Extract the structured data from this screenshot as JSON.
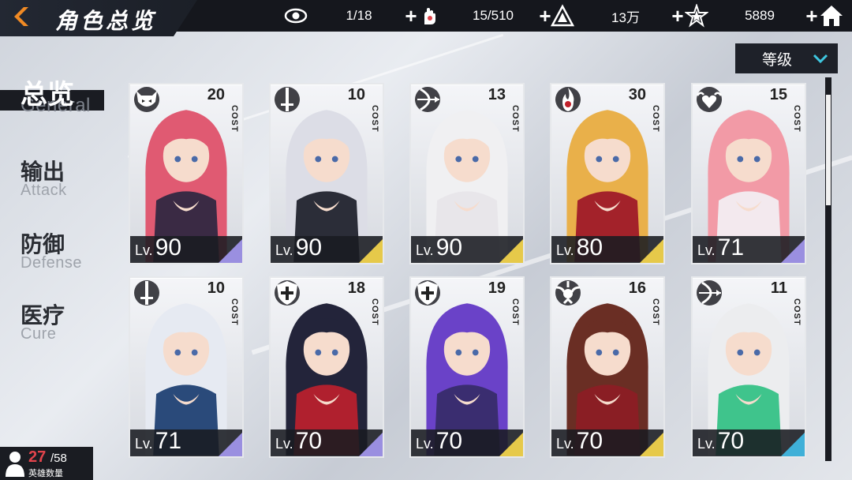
{
  "header": {
    "title": "角色总览",
    "resources": [
      {
        "icon": "eye-icon",
        "value": "1/18"
      },
      {
        "icon": "stamina-hand-icon",
        "value": "15/510"
      },
      {
        "icon": "gold-pyramid-icon",
        "value": "13万"
      },
      {
        "icon": "star-crystal-icon",
        "value": "5889"
      }
    ]
  },
  "sort": {
    "label": "等级"
  },
  "categories": [
    {
      "cn": "总览",
      "en": "General",
      "active": true
    },
    {
      "cn": "输出",
      "en": "Attack",
      "active": false
    },
    {
      "cn": "防御",
      "en": "Defense",
      "active": false
    },
    {
      "cn": "医疗",
      "en": "Cure",
      "active": false
    }
  ],
  "cost_label": "COST",
  "lv_prefix": "Lv.",
  "cards": [
    {
      "class_icon": "demon-mask-icon",
      "cost": "20",
      "level": "90",
      "rarity_color": "#9a8fe0",
      "hair": "#e05a72",
      "outfit": "#3a2a44"
    },
    {
      "class_icon": "sword-icon",
      "cost": "10",
      "level": "90",
      "rarity_color": "#e6c94a",
      "hair": "#dcdde6",
      "outfit": "#2b2d38"
    },
    {
      "class_icon": "bow-icon",
      "cost": "13",
      "level": "90",
      "rarity_color": "#e6c94a",
      "hair": "#f0f0f2",
      "outfit": "#e8e6ea"
    },
    {
      "class_icon": "flame-icon",
      "cost": "30",
      "level": "80",
      "rarity_color": "#e6c94a",
      "hair": "#e9b04a",
      "outfit": "#a3222a"
    },
    {
      "class_icon": "heart-wings-icon",
      "cost": "15",
      "level": "71",
      "rarity_color": "#9a8fe0",
      "hair": "#f29aa6",
      "outfit": "#f3e9ee"
    },
    {
      "class_icon": "sword-icon",
      "cost": "10",
      "level": "71",
      "rarity_color": "#9a8fe0",
      "hair": "#e6eaf2",
      "outfit": "#2a4a7a"
    },
    {
      "class_icon": "shield-cross-icon",
      "cost": "18",
      "level": "70",
      "rarity_color": "#9a8fe0",
      "hair": "#23243a",
      "outfit": "#b0202e"
    },
    {
      "class_icon": "shield-cross-icon",
      "cost": "19",
      "level": "70",
      "rarity_color": "#e6c94a",
      "hair": "#6a42c8",
      "outfit": "#3a2d70"
    },
    {
      "class_icon": "winged-emblem-icon",
      "cost": "16",
      "level": "70",
      "rarity_color": "#e6c94a",
      "hair": "#6a2e24",
      "outfit": "#8a1e24"
    },
    {
      "class_icon": "bow-icon",
      "cost": "11",
      "level": "70",
      "rarity_color": "#3fb0d8",
      "hair": "#ecedef",
      "outfit": "#3fc48c"
    }
  ],
  "hero_count": {
    "current": "27",
    "total": "/58",
    "label": "英雄数量"
  }
}
